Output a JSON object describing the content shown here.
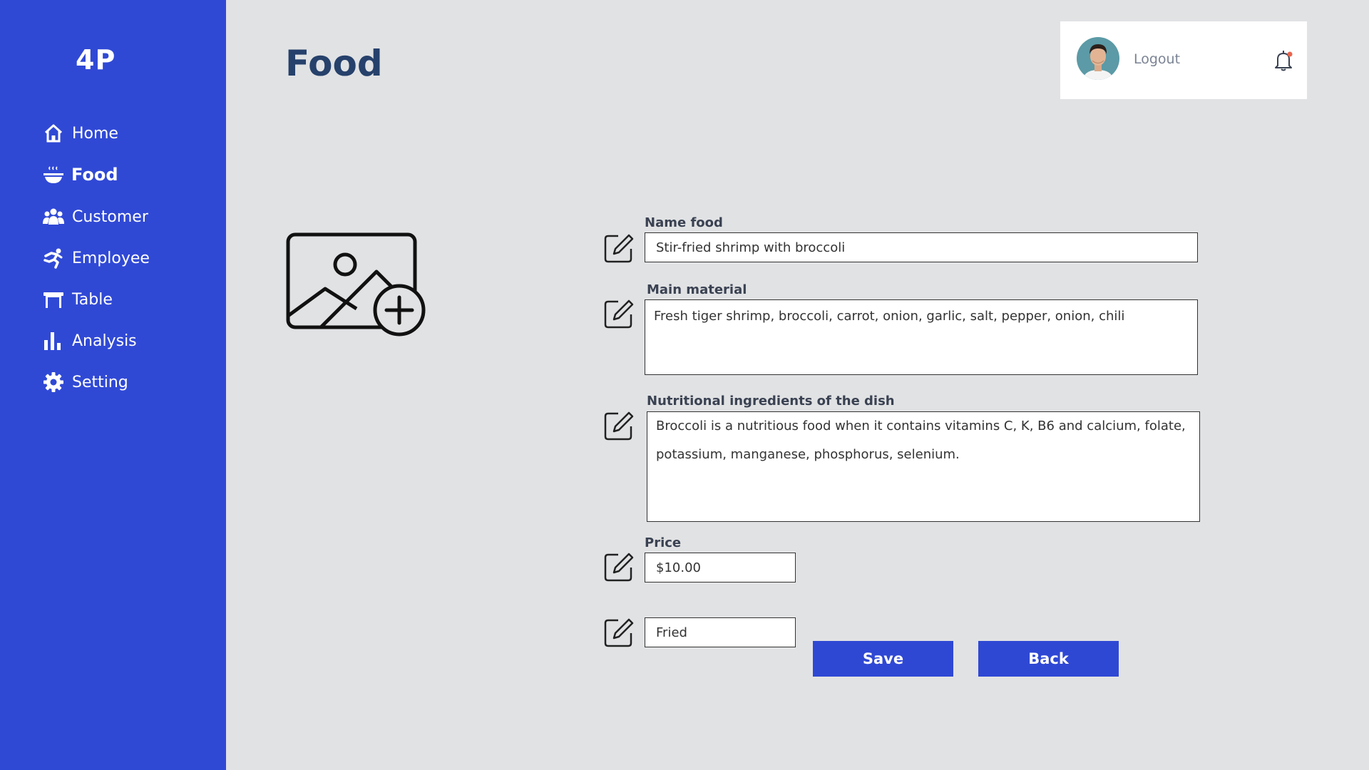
{
  "app": {
    "logo": "4P"
  },
  "sidebar": {
    "items": [
      {
        "label": "Home",
        "icon": "home-icon",
        "active": false
      },
      {
        "label": "Food",
        "icon": "food-bowl-icon",
        "active": true
      },
      {
        "label": "Customer",
        "icon": "users-icon",
        "active": false
      },
      {
        "label": "Employee",
        "icon": "person-running-icon",
        "active": false
      },
      {
        "label": "Table",
        "icon": "table-icon",
        "active": false
      },
      {
        "label": "Analysis",
        "icon": "bar-chart-icon",
        "active": false
      },
      {
        "label": "Setting",
        "icon": "gear-icon",
        "active": false
      }
    ]
  },
  "header": {
    "title": "Food",
    "logout_label": "Logout"
  },
  "form": {
    "name_food": {
      "label": "Name food",
      "value": "Stir-fried shrimp with broccoli"
    },
    "main_material": {
      "label": "Main material",
      "value": "Fresh tiger shrimp, broccoli, carrot, onion, garlic, salt, pepper, onion, chili"
    },
    "nutrition": {
      "label": "Nutritional ingredients of the dish",
      "value": "Broccoli is a nutritious food when it contains vitamins C, K, B6 and calcium, folate, potassium, manganese, phosphorus, selenium."
    },
    "price": {
      "label": "Price",
      "value": "$10.00"
    },
    "category": {
      "value": "Fried"
    }
  },
  "buttons": {
    "save": "Save",
    "back": "Back"
  },
  "colors": {
    "sidebar": "#3049d5",
    "background": "#e1e2e4",
    "title": "#26416b",
    "button": "#2f48d4",
    "notification_dot": "#e8664d"
  }
}
